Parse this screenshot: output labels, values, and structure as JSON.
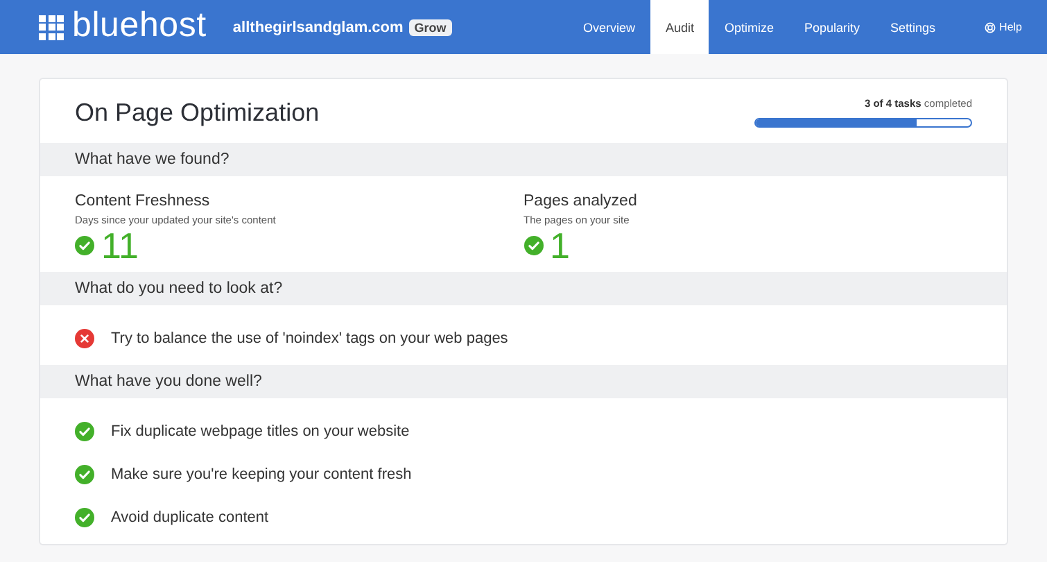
{
  "header": {
    "logo": "bluehost",
    "site": "allthegirlsandglam.com",
    "plan_badge": "Grow",
    "nav": [
      {
        "label": "Overview",
        "selected": false
      },
      {
        "label": "Audit",
        "selected": true
      },
      {
        "label": "Optimize",
        "selected": false
      },
      {
        "label": "Popularity",
        "selected": false
      },
      {
        "label": "Settings",
        "selected": false
      }
    ],
    "help": "Help"
  },
  "card": {
    "title": "On Page Optimization",
    "progress": {
      "text": "**3 of 4 tasks** completed",
      "level": 0.75
    },
    "found": {
      "heading": "What have we found?",
      "metrics": [
        {
          "name": "Content Freshness",
          "description": "Days since your updated your site's content",
          "kind": "pass",
          "value": "11"
        },
        {
          "name": "Pages analyzed",
          "description": "The pages on your site",
          "kind": "pass",
          "value": "1"
        }
      ]
    },
    "sections": [
      {
        "heading": "What do you need to look at?",
        "items": [
          {
            "kind": "fail",
            "text": "Try to balance the use of 'noindex' tags on your web pages"
          }
        ]
      },
      {
        "heading": "What have you done well?",
        "items": [
          {
            "kind": "pass",
            "text": "Fix duplicate webpage titles on your website"
          },
          {
            "kind": "pass",
            "text": "Make sure you're keeping your content fresh"
          },
          {
            "kind": "pass",
            "text": "Avoid duplicate content"
          }
        ]
      }
    ]
  }
}
